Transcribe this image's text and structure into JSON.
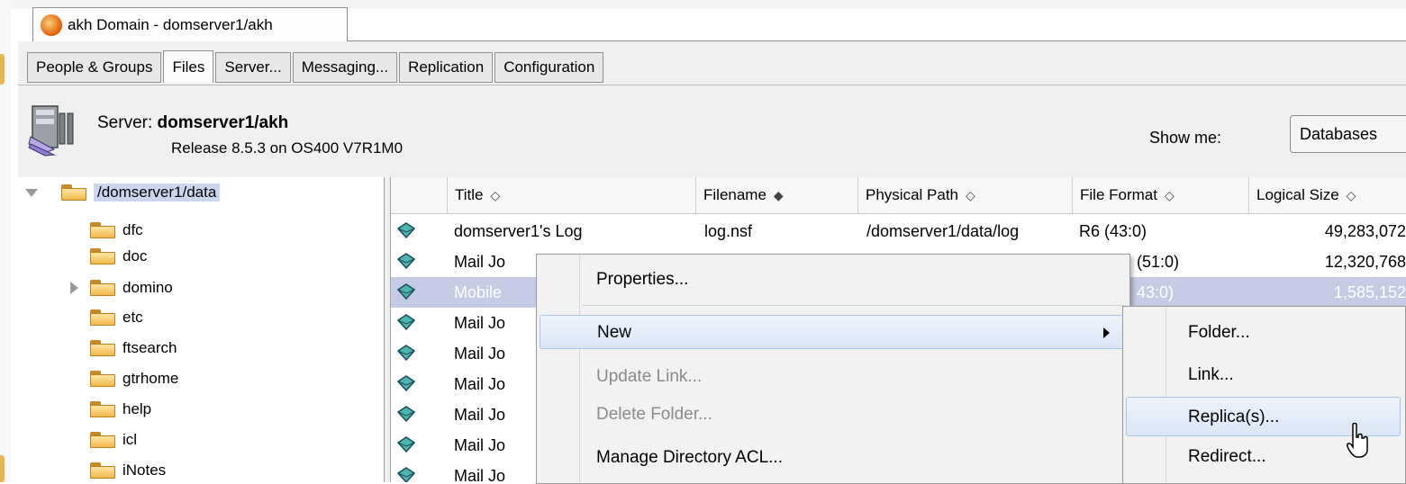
{
  "window": {
    "tab_title": "akh Domain - domserver1/akh"
  },
  "tabs": [
    {
      "label": "People & Groups"
    },
    {
      "label": "Files"
    },
    {
      "label": "Server..."
    },
    {
      "label": "Messaging..."
    },
    {
      "label": "Replication"
    },
    {
      "label": "Configuration"
    }
  ],
  "active_tab": "Files",
  "server": {
    "prefix": "Server: ",
    "name": "domserver1/akh",
    "release": "Release 8.5.3 on OS400 V7R1M0",
    "show_me_label": "Show me:",
    "show_me_value": "Databases"
  },
  "tree": {
    "root": "/domserver1/data",
    "items": [
      "dfc",
      "doc",
      "domino",
      "etc",
      "ftsearch",
      "gtrhome",
      "help",
      "icl",
      "iNotes"
    ]
  },
  "grid": {
    "columns": [
      "Title",
      "Filename",
      "Physical Path",
      "File Format",
      "Logical Size"
    ],
    "sort_indicators": [
      "◇",
      "◆",
      "◇",
      "◇",
      "◇"
    ],
    "rows": [
      {
        "title": "domserver1's Log",
        "filename": "log.nsf",
        "path": "/domserver1/data/log",
        "format": "R6 (43:0)",
        "size": "49,283,072"
      },
      {
        "title": "Mail Jo",
        "filename": "",
        "path": "",
        "format": "(51:0)",
        "size": "12,320,768"
      },
      {
        "title": "Mobile",
        "filename": "",
        "path": "",
        "format": "43:0)",
        "size": "1,585,152"
      },
      {
        "title": "Mail Jo",
        "filename": "",
        "path": "",
        "format": "",
        "size": ""
      },
      {
        "title": "Mail Jo",
        "filename": "",
        "path": "",
        "format": "",
        "size": ""
      },
      {
        "title": "Mail Jo",
        "filename": "",
        "path": "",
        "format": "",
        "size": ""
      },
      {
        "title": "Mail Jo",
        "filename": "",
        "path": "",
        "format": "",
        "size": ""
      },
      {
        "title": "Mail Jo",
        "filename": "",
        "path": "",
        "format": "",
        "size": ""
      },
      {
        "title": "Mail Jo",
        "filename": "",
        "path": "",
        "format": "",
        "size": ""
      }
    ]
  },
  "context_menu": {
    "items": [
      {
        "label": "Properties...",
        "enabled": true
      },
      {
        "label": "New",
        "enabled": true,
        "submenu": true
      },
      {
        "label": "Update Link...",
        "enabled": false
      },
      {
        "label": "Delete Folder...",
        "enabled": false
      },
      {
        "label": "Manage Directory ACL...",
        "enabled": true
      }
    ]
  },
  "submenu": {
    "items": [
      {
        "label": "Folder..."
      },
      {
        "label": "Link..."
      },
      {
        "label": "Replica(s)..."
      },
      {
        "label": "Redirect..."
      }
    ]
  },
  "colors": {
    "selection": "#c5cbe5",
    "menu_hover": "#dbe6f6",
    "folder": "#f2b84b"
  }
}
